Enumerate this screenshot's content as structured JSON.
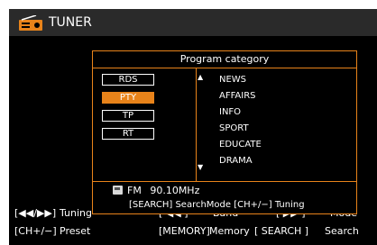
{
  "header": {
    "title": "TUNER",
    "icon": "radio-icon"
  },
  "footer": {
    "line1": {
      "key1": "[◀◀/▶▶]",
      "label1": "Tuning",
      "key2": "[ ◀◀ ]",
      "label2": "Band",
      "key3": "[ ▶▶ ]",
      "label3": "Mode"
    },
    "line2": {
      "key1": "[CH+/−]",
      "label1": "Preset",
      "key2": "[MEMORY]",
      "label2": "Memory",
      "key3": "[ SEARCH ]",
      "label3": "Search"
    }
  },
  "dialog": {
    "title": "Program category",
    "modes": [
      {
        "label": "RDS",
        "selected": false
      },
      {
        "label": "PTY",
        "selected": true
      },
      {
        "label": "TP",
        "selected": false
      },
      {
        "label": "RT",
        "selected": false
      }
    ],
    "categories": [
      "NEWS",
      "AFFAIRS",
      "INFO",
      "SPORT",
      "EDUCATE",
      "DRAMA"
    ],
    "scroll_up_icon": "arrow-up-icon",
    "scroll_down_icon": "arrow-down-icon",
    "up_glyph": "▲",
    "down_glyph": "▼",
    "band": "FM",
    "frequency": "90.10MHz",
    "hint": "[SEARCH] SearchMode [CH+/−] Tuning"
  },
  "colors": {
    "accent": "#e8831a",
    "background": "#000000",
    "text": "#ffffff",
    "titlebar": "#2a2a2a"
  }
}
